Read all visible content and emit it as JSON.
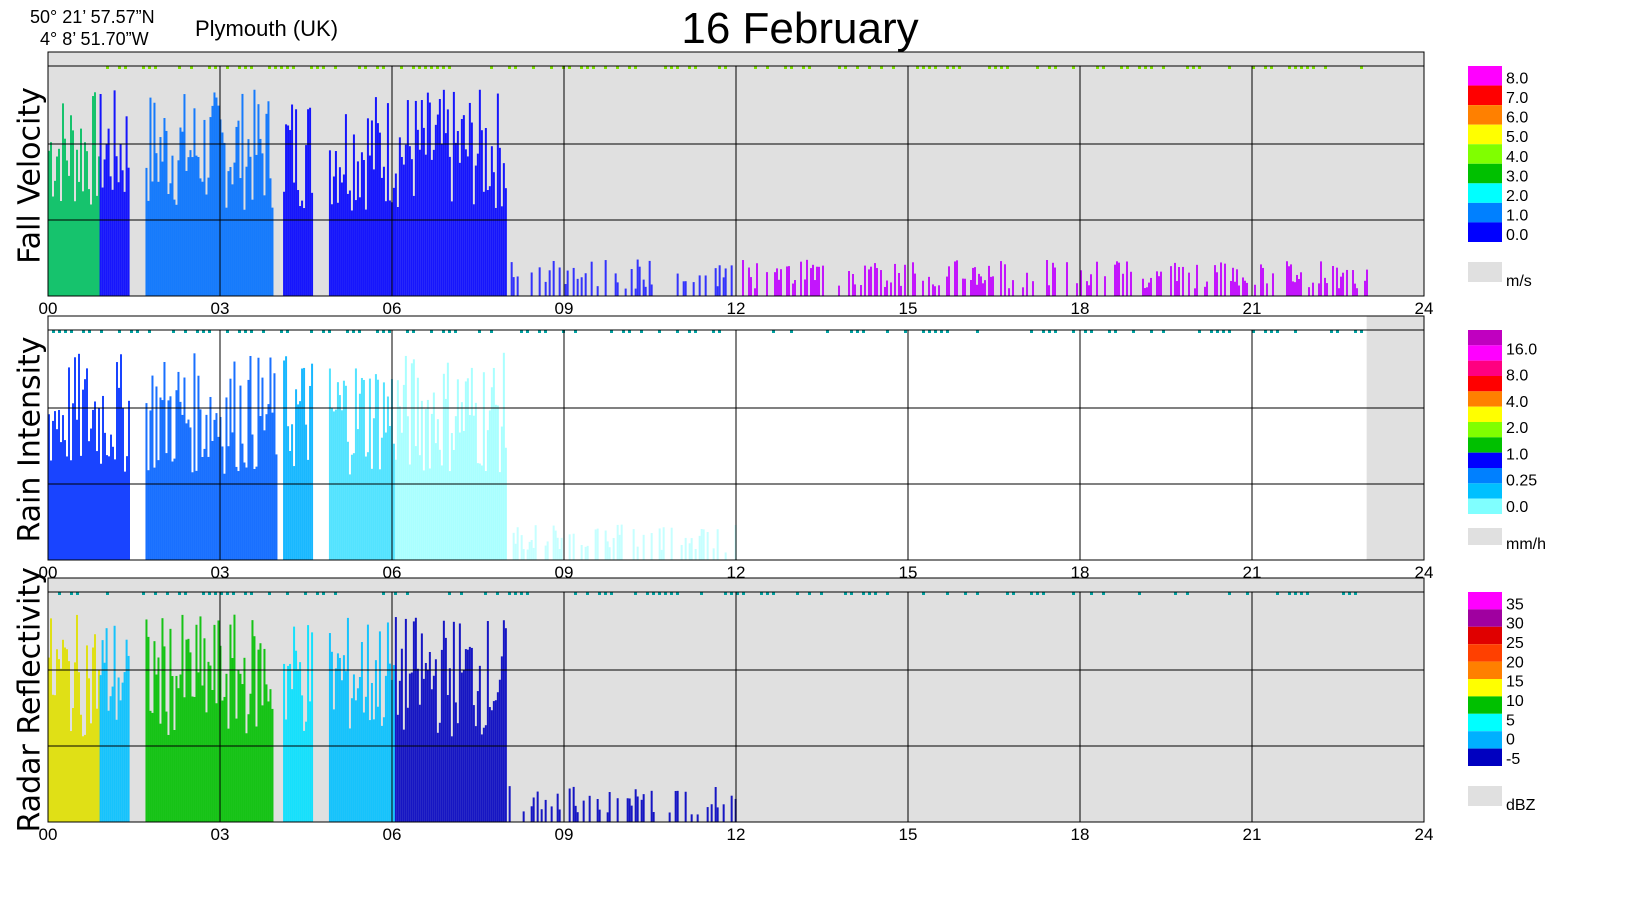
{
  "header": {
    "lat": "50° 21’ 57.57”N",
    "lon": "4°  8’ 51.70”W",
    "location": "Plymouth (UK)",
    "title": "16 February"
  },
  "chart_data": [
    {
      "type": "heatmap",
      "ylabel": "Fall Velocity",
      "x_ticks": [
        "00",
        "03",
        "06",
        "09",
        "12",
        "15",
        "18",
        "21",
        "24"
      ],
      "xlim": [
        0,
        24
      ],
      "colorbar_unit": "m/s",
      "colorbar_ticks": [
        "8.0",
        "7.0",
        "6.0",
        "5.0",
        "4.0",
        "3.0",
        "2.0",
        "1.0",
        "0.0"
      ],
      "colorbar_colors": [
        "#ff00ff",
        "#ff0000",
        "#ff8000",
        "#ffff00",
        "#80ff00",
        "#00c000",
        "#00ffff",
        "#0080ff",
        "#0000ff"
      ],
      "nodata_color": "#e0e0e0",
      "background": "#e0e0e0",
      "activity_hours": [
        [
          0.0,
          0.9,
          "#00c060"
        ],
        [
          0.9,
          1.4,
          "#0000ff"
        ],
        [
          1.7,
          3.9,
          "#0070ff"
        ],
        [
          4.1,
          4.6,
          "#0000ff"
        ],
        [
          4.9,
          6.05,
          "#0000ff"
        ],
        [
          6.05,
          8.0,
          "#0000ff"
        ],
        [
          8.0,
          12.0,
          "#2020ff"
        ],
        [
          12.0,
          23.0,
          "#c000ff"
        ]
      ]
    },
    {
      "type": "heatmap",
      "ylabel": "Rain Intensity",
      "x_ticks": [
        "00",
        "03",
        "06",
        "09",
        "12",
        "15",
        "18",
        "21",
        "24"
      ],
      "xlim": [
        0,
        24
      ],
      "colorbar_unit": "mm/h",
      "colorbar_ticks": [
        "16.0",
        "8.0",
        "4.0",
        "2.0",
        "1.0",
        "0.25",
        "0.0"
      ],
      "colorbar_colors": [
        "#c000c0",
        "#ff00ff",
        "#ff0080",
        "#ff0000",
        "#ff8000",
        "#ffff00",
        "#80ff00",
        "#00c000",
        "#0000ff",
        "#0080ff",
        "#00c0ff",
        "#80ffff"
      ],
      "nodata_color": "#e0e0e0",
      "background": "#ffffff",
      "activity_hours": [
        [
          0.0,
          1.4,
          "#0030ff"
        ],
        [
          1.7,
          4.0,
          "#0060ff"
        ],
        [
          4.1,
          4.6,
          "#00b0ff"
        ],
        [
          4.9,
          6.05,
          "#40e0ff"
        ],
        [
          6.05,
          8.0,
          "#a0ffff"
        ],
        [
          8.0,
          12.0,
          "#c0ffff"
        ]
      ],
      "nodata_hours": [
        23.0,
        24.0
      ]
    },
    {
      "type": "heatmap",
      "ylabel": "Radar Reflectivity",
      "x_ticks": [
        "00",
        "03",
        "06",
        "09",
        "12",
        "15",
        "18",
        "21",
        "24"
      ],
      "xlim": [
        0,
        24
      ],
      "colorbar_unit": "dBZ",
      "colorbar_ticks": [
        "35",
        "30",
        "25",
        "20",
        "15",
        "10",
        "5",
        "0",
        "-5"
      ],
      "colorbar_colors": [
        "#ff00ff",
        "#a000a0",
        "#e00000",
        "#ff4000",
        "#ff8000",
        "#ffff00",
        "#00c000",
        "#00ffff",
        "#00b0ff",
        "#0000c0"
      ],
      "nodata_color": "#e0e0e0",
      "background": "#e0e0e0",
      "activity_hours": [
        [
          0.0,
          0.9,
          "#e0e000"
        ],
        [
          0.9,
          1.4,
          "#00c0ff"
        ],
        [
          1.7,
          3.9,
          "#00c000"
        ],
        [
          4.1,
          4.6,
          "#00e0ff"
        ],
        [
          4.9,
          6.05,
          "#00c0ff"
        ],
        [
          6.05,
          8.0,
          "#0000c0"
        ],
        [
          8.0,
          12.0,
          "#0000c0"
        ]
      ]
    }
  ]
}
